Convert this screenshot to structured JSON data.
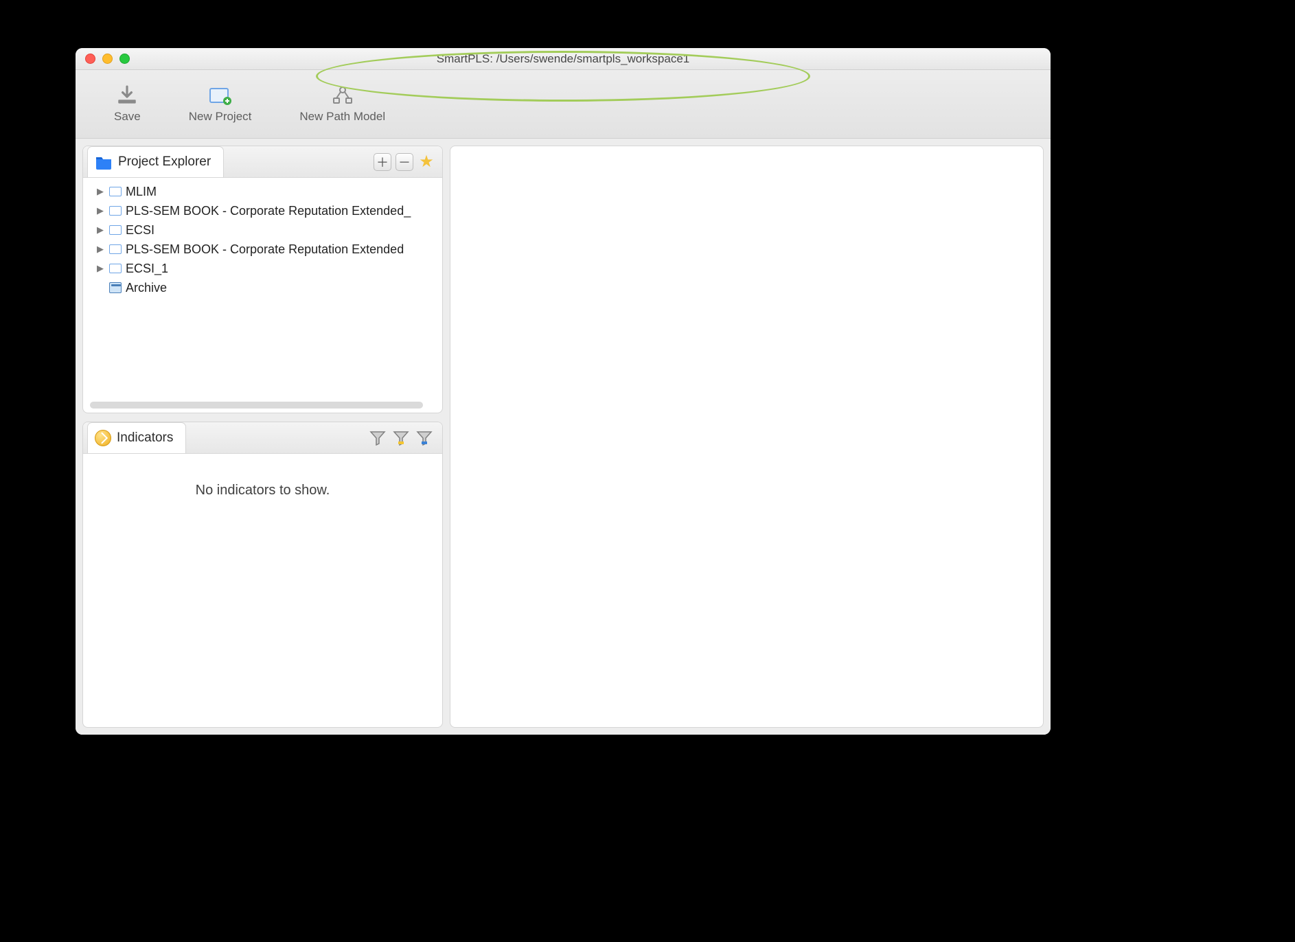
{
  "window": {
    "title": "SmartPLS: /Users/swende/smartpls_workspace1"
  },
  "toolbar": {
    "save": "Save",
    "new_project": "New Project",
    "new_path_model": "New Path Model"
  },
  "explorer": {
    "title": "Project Explorer",
    "items": [
      {
        "label": "MLIM"
      },
      {
        "label": "PLS-SEM BOOK - Corporate Reputation Extended_"
      },
      {
        "label": "ECSI"
      },
      {
        "label": "PLS-SEM BOOK - Corporate Reputation Extended"
      },
      {
        "label": "ECSI_1"
      }
    ],
    "archive_label": "Archive"
  },
  "indicators": {
    "title": "Indicators",
    "empty_text": "No indicators to show."
  }
}
